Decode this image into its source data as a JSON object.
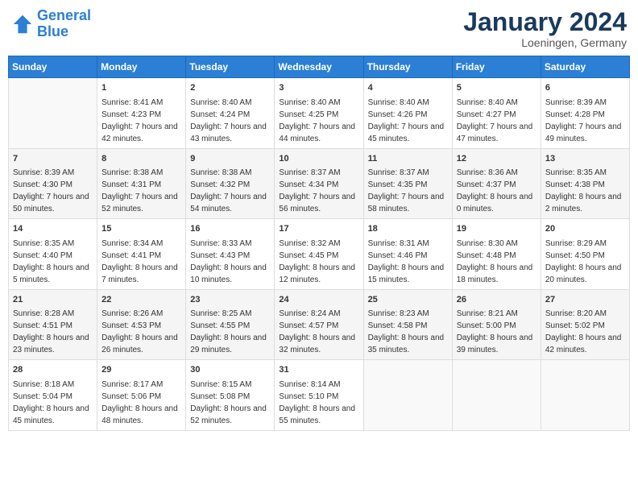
{
  "header": {
    "logo_line1": "General",
    "logo_line2": "Blue",
    "month_title": "January 2024",
    "location": "Loeningen, Germany"
  },
  "days_of_week": [
    "Sunday",
    "Monday",
    "Tuesday",
    "Wednesday",
    "Thursday",
    "Friday",
    "Saturday"
  ],
  "weeks": [
    [
      {
        "day": "",
        "sunrise": "",
        "sunset": "",
        "daylight": ""
      },
      {
        "day": "1",
        "sunrise": "Sunrise: 8:41 AM",
        "sunset": "Sunset: 4:23 PM",
        "daylight": "Daylight: 7 hours and 42 minutes."
      },
      {
        "day": "2",
        "sunrise": "Sunrise: 8:40 AM",
        "sunset": "Sunset: 4:24 PM",
        "daylight": "Daylight: 7 hours and 43 minutes."
      },
      {
        "day": "3",
        "sunrise": "Sunrise: 8:40 AM",
        "sunset": "Sunset: 4:25 PM",
        "daylight": "Daylight: 7 hours and 44 minutes."
      },
      {
        "day": "4",
        "sunrise": "Sunrise: 8:40 AM",
        "sunset": "Sunset: 4:26 PM",
        "daylight": "Daylight: 7 hours and 45 minutes."
      },
      {
        "day": "5",
        "sunrise": "Sunrise: 8:40 AM",
        "sunset": "Sunset: 4:27 PM",
        "daylight": "Daylight: 7 hours and 47 minutes."
      },
      {
        "day": "6",
        "sunrise": "Sunrise: 8:39 AM",
        "sunset": "Sunset: 4:28 PM",
        "daylight": "Daylight: 7 hours and 49 minutes."
      }
    ],
    [
      {
        "day": "7",
        "sunrise": "Sunrise: 8:39 AM",
        "sunset": "Sunset: 4:30 PM",
        "daylight": "Daylight: 7 hours and 50 minutes."
      },
      {
        "day": "8",
        "sunrise": "Sunrise: 8:38 AM",
        "sunset": "Sunset: 4:31 PM",
        "daylight": "Daylight: 7 hours and 52 minutes."
      },
      {
        "day": "9",
        "sunrise": "Sunrise: 8:38 AM",
        "sunset": "Sunset: 4:32 PM",
        "daylight": "Daylight: 7 hours and 54 minutes."
      },
      {
        "day": "10",
        "sunrise": "Sunrise: 8:37 AM",
        "sunset": "Sunset: 4:34 PM",
        "daylight": "Daylight: 7 hours and 56 minutes."
      },
      {
        "day": "11",
        "sunrise": "Sunrise: 8:37 AM",
        "sunset": "Sunset: 4:35 PM",
        "daylight": "Daylight: 7 hours and 58 minutes."
      },
      {
        "day": "12",
        "sunrise": "Sunrise: 8:36 AM",
        "sunset": "Sunset: 4:37 PM",
        "daylight": "Daylight: 8 hours and 0 minutes."
      },
      {
        "day": "13",
        "sunrise": "Sunrise: 8:35 AM",
        "sunset": "Sunset: 4:38 PM",
        "daylight": "Daylight: 8 hours and 2 minutes."
      }
    ],
    [
      {
        "day": "14",
        "sunrise": "Sunrise: 8:35 AM",
        "sunset": "Sunset: 4:40 PM",
        "daylight": "Daylight: 8 hours and 5 minutes."
      },
      {
        "day": "15",
        "sunrise": "Sunrise: 8:34 AM",
        "sunset": "Sunset: 4:41 PM",
        "daylight": "Daylight: 8 hours and 7 minutes."
      },
      {
        "day": "16",
        "sunrise": "Sunrise: 8:33 AM",
        "sunset": "Sunset: 4:43 PM",
        "daylight": "Daylight: 8 hours and 10 minutes."
      },
      {
        "day": "17",
        "sunrise": "Sunrise: 8:32 AM",
        "sunset": "Sunset: 4:45 PM",
        "daylight": "Daylight: 8 hours and 12 minutes."
      },
      {
        "day": "18",
        "sunrise": "Sunrise: 8:31 AM",
        "sunset": "Sunset: 4:46 PM",
        "daylight": "Daylight: 8 hours and 15 minutes."
      },
      {
        "day": "19",
        "sunrise": "Sunrise: 8:30 AM",
        "sunset": "Sunset: 4:48 PM",
        "daylight": "Daylight: 8 hours and 18 minutes."
      },
      {
        "day": "20",
        "sunrise": "Sunrise: 8:29 AM",
        "sunset": "Sunset: 4:50 PM",
        "daylight": "Daylight: 8 hours and 20 minutes."
      }
    ],
    [
      {
        "day": "21",
        "sunrise": "Sunrise: 8:28 AM",
        "sunset": "Sunset: 4:51 PM",
        "daylight": "Daylight: 8 hours and 23 minutes."
      },
      {
        "day": "22",
        "sunrise": "Sunrise: 8:26 AM",
        "sunset": "Sunset: 4:53 PM",
        "daylight": "Daylight: 8 hours and 26 minutes."
      },
      {
        "day": "23",
        "sunrise": "Sunrise: 8:25 AM",
        "sunset": "Sunset: 4:55 PM",
        "daylight": "Daylight: 8 hours and 29 minutes."
      },
      {
        "day": "24",
        "sunrise": "Sunrise: 8:24 AM",
        "sunset": "Sunset: 4:57 PM",
        "daylight": "Daylight: 8 hours and 32 minutes."
      },
      {
        "day": "25",
        "sunrise": "Sunrise: 8:23 AM",
        "sunset": "Sunset: 4:58 PM",
        "daylight": "Daylight: 8 hours and 35 minutes."
      },
      {
        "day": "26",
        "sunrise": "Sunrise: 8:21 AM",
        "sunset": "Sunset: 5:00 PM",
        "daylight": "Daylight: 8 hours and 39 minutes."
      },
      {
        "day": "27",
        "sunrise": "Sunrise: 8:20 AM",
        "sunset": "Sunset: 5:02 PM",
        "daylight": "Daylight: 8 hours and 42 minutes."
      }
    ],
    [
      {
        "day": "28",
        "sunrise": "Sunrise: 8:18 AM",
        "sunset": "Sunset: 5:04 PM",
        "daylight": "Daylight: 8 hours and 45 minutes."
      },
      {
        "day": "29",
        "sunrise": "Sunrise: 8:17 AM",
        "sunset": "Sunset: 5:06 PM",
        "daylight": "Daylight: 8 hours and 48 minutes."
      },
      {
        "day": "30",
        "sunrise": "Sunrise: 8:15 AM",
        "sunset": "Sunset: 5:08 PM",
        "daylight": "Daylight: 8 hours and 52 minutes."
      },
      {
        "day": "31",
        "sunrise": "Sunrise: 8:14 AM",
        "sunset": "Sunset: 5:10 PM",
        "daylight": "Daylight: 8 hours and 55 minutes."
      },
      {
        "day": "",
        "sunrise": "",
        "sunset": "",
        "daylight": ""
      },
      {
        "day": "",
        "sunrise": "",
        "sunset": "",
        "daylight": ""
      },
      {
        "day": "",
        "sunrise": "",
        "sunset": "",
        "daylight": ""
      }
    ]
  ]
}
